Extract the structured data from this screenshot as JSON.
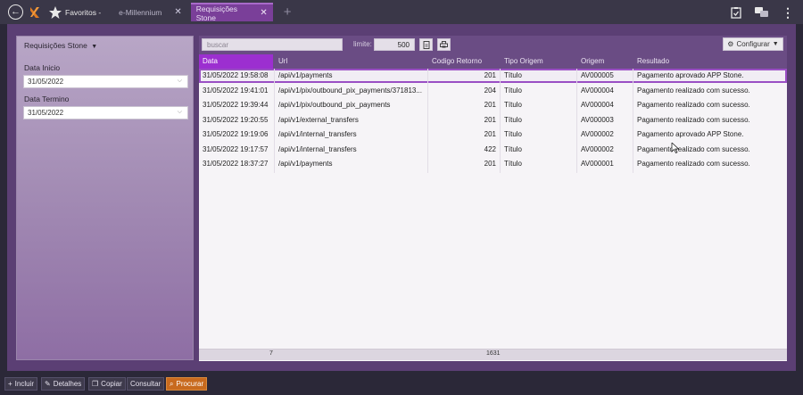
{
  "topbar": {
    "favorites_label": "Favoritos -",
    "tabs": [
      {
        "label": "e-Millennium",
        "close": "✕"
      },
      {
        "label": "Requisições Stone",
        "close": "✕"
      }
    ],
    "add_tab": "+",
    "menu_dots": "⋮",
    "icons": [
      "back-icon",
      "logo-icon",
      "star-icon",
      "clipboard-check-icon",
      "chat-icon",
      "more-vertical-icon"
    ]
  },
  "filter": {
    "title": "Requisições Stone",
    "start_label": "Data Inicio",
    "start_value": "31/05/2022",
    "end_label": "Data Termino",
    "end_value": "31/05/2022"
  },
  "toolbar": {
    "search_placeholder": "buscar",
    "limit_label": "limite:",
    "limit_value": "500",
    "config_label": "Configurar"
  },
  "table": {
    "columns": [
      "Data",
      "Url",
      "Codigo Retorno",
      "Tipo Origem",
      "Origem",
      "Resultado"
    ],
    "rows": [
      [
        "31/05/2022 19:58:08",
        "/api/v1/payments",
        "201",
        "Título",
        "AV000005",
        "Pagamento aprovado APP Stone."
      ],
      [
        "31/05/2022 19:41:01",
        "/api/v1/pix/outbound_pix_payments/371813...",
        "204",
        "Título",
        "AV000004",
        "Pagamento realizado com sucesso."
      ],
      [
        "31/05/2022 19:39:44",
        "/api/v1/pix/outbound_pix_payments",
        "201",
        "Título",
        "AV000004",
        "Pagamento realizado com sucesso."
      ],
      [
        "31/05/2022 19:20:55",
        "/api/v1/external_transfers",
        "201",
        "Título",
        "AV000003",
        "Pagamento realizado com sucesso."
      ],
      [
        "31/05/2022 19:19:06",
        "/api/v1/internal_transfers",
        "201",
        "Título",
        "AV000002",
        "Pagamento aprovado APP Stone."
      ],
      [
        "31/05/2022 19:17:57",
        "/api/v1/internal_transfers",
        "422",
        "Título",
        "AV000002",
        "Pagamento realizado com sucesso."
      ],
      [
        "31/05/2022 18:37:27",
        "/api/v1/payments",
        "201",
        "Título",
        "AV000001",
        "Pagamento realizado com sucesso."
      ]
    ],
    "footer_count": "7",
    "footer_sum": "1631"
  },
  "bottom": {
    "incluir": "Incluir",
    "detalhes": "Detalhes",
    "copiar": "Copiar",
    "consultar": "Consultar",
    "procurar": "Procurar"
  },
  "colors": {
    "accent": "#9c2fd0",
    "panel": "#6a4c84",
    "highlight_button": "#c86a1e"
  }
}
